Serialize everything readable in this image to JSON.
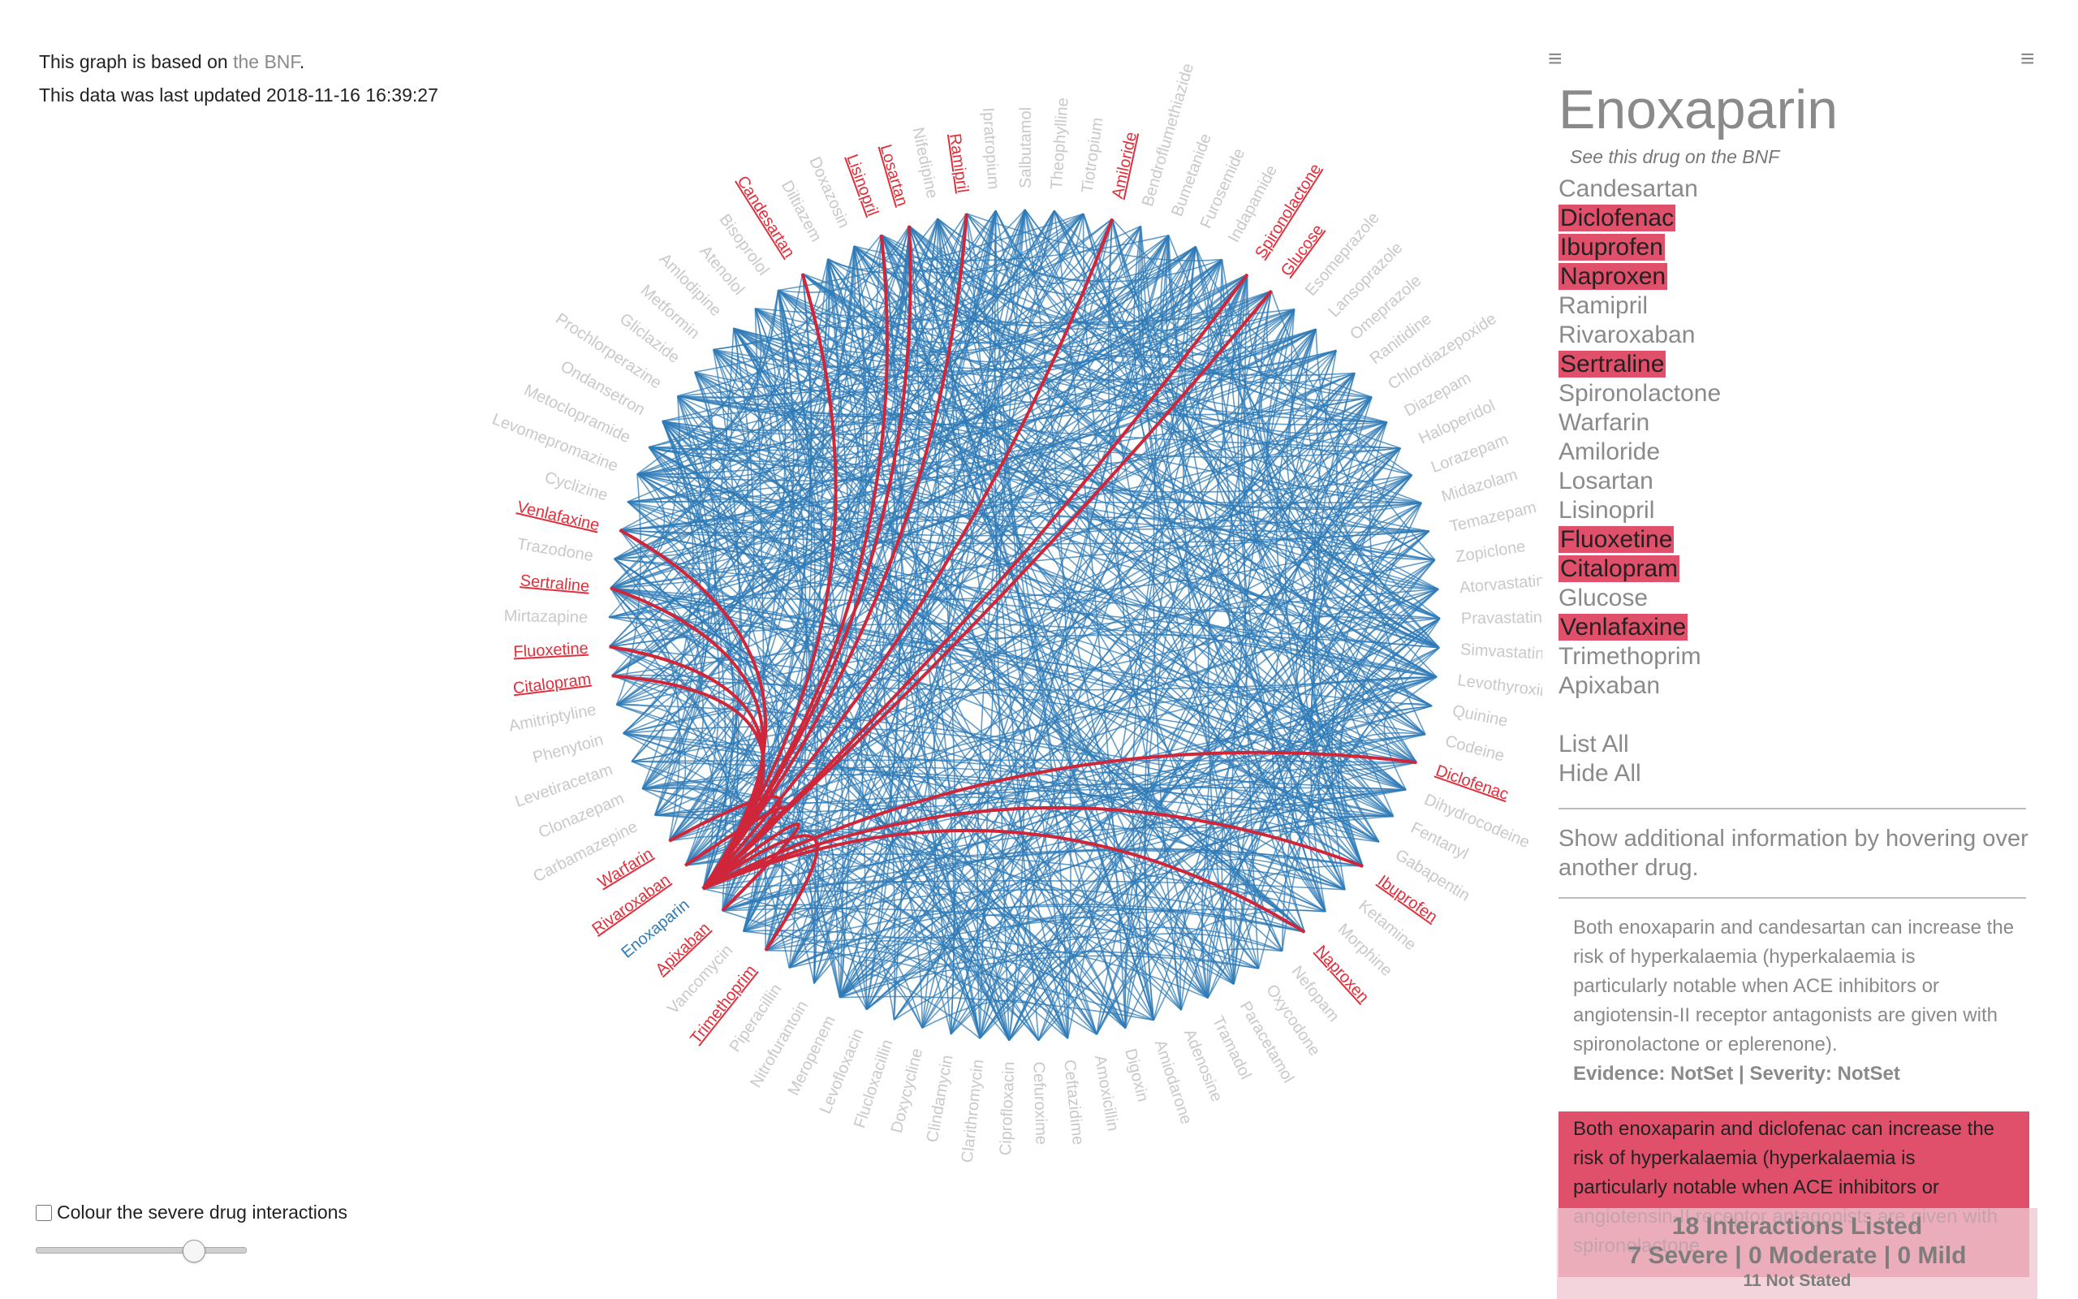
{
  "info": {
    "line1_prefix": "This graph is based on ",
    "line1_link": "the BNF",
    "line1_suffix": ".",
    "line2": "This data was last updated 2018-11-16 16:39:27"
  },
  "controls": {
    "severe_checkbox_label": "Colour the severe drug interactions",
    "slider_value_fraction": 0.78
  },
  "colors": {
    "edge": "#2f7bb7",
    "severe_edge": "#d0263a",
    "label": "#c9c9c9",
    "highlight": "#e0303c",
    "panel_highlight": "#e0506a"
  },
  "graph": {
    "focus_drug": "Enoxaparin",
    "drugs": [
      {
        "name": "Ipratropium"
      },
      {
        "name": "Salbutamol"
      },
      {
        "name": "Theophylline"
      },
      {
        "name": "Tiotropium"
      },
      {
        "name": "Amiloride",
        "hl": true
      },
      {
        "name": "Bendroflumethiazide"
      },
      {
        "name": "Bumetanide"
      },
      {
        "name": "Furosemide"
      },
      {
        "name": "Indapamide"
      },
      {
        "name": "Spironolactone",
        "hl": true
      },
      {
        "name": "Glucose",
        "hl": true
      },
      {
        "name": "Esomeprazole"
      },
      {
        "name": "Lansoprazole"
      },
      {
        "name": "Omeprazole"
      },
      {
        "name": "Ranitidine"
      },
      {
        "name": "Chlordiazepoxide"
      },
      {
        "name": "Diazepam"
      },
      {
        "name": "Haloperidol"
      },
      {
        "name": "Lorazepam"
      },
      {
        "name": "Midazolam"
      },
      {
        "name": "Temazepam"
      },
      {
        "name": "Zopiclone"
      },
      {
        "name": "Atorvastatin"
      },
      {
        "name": "Pravastatin"
      },
      {
        "name": "Simvastatin"
      },
      {
        "name": "Levothyroxine"
      },
      {
        "name": "Quinine"
      },
      {
        "name": "Codeine"
      },
      {
        "name": "Diclofenac",
        "hl": true
      },
      {
        "name": "Dihydrocodeine"
      },
      {
        "name": "Fentanyl"
      },
      {
        "name": "Gabapentin"
      },
      {
        "name": "Ibuprofen",
        "hl": true
      },
      {
        "name": "Ketamine"
      },
      {
        "name": "Morphine"
      },
      {
        "name": "Naproxen",
        "hl": true
      },
      {
        "name": "Nefopam"
      },
      {
        "name": "Oxycodone"
      },
      {
        "name": "Paracetamol"
      },
      {
        "name": "Tramadol"
      },
      {
        "name": "Adenosine"
      },
      {
        "name": "Amiodarone"
      },
      {
        "name": "Digoxin"
      },
      {
        "name": "Amoxicillin"
      },
      {
        "name": "Ceftazidime"
      },
      {
        "name": "Cefuroxime"
      },
      {
        "name": "Ciprofloxacin"
      },
      {
        "name": "Clarithromycin"
      },
      {
        "name": "Clindamycin"
      },
      {
        "name": "Doxycycline"
      },
      {
        "name": "Flucloxacillin"
      },
      {
        "name": "Levofloxacin"
      },
      {
        "name": "Meropenem"
      },
      {
        "name": "Nitrofurantoin"
      },
      {
        "name": "Piperacillin"
      },
      {
        "name": "Trimethoprim",
        "hl": true
      },
      {
        "name": "Vancomycin"
      },
      {
        "name": "Apixaban",
        "hl": true
      },
      {
        "name": "Enoxaparin",
        "focus": true
      },
      {
        "name": "Rivaroxaban",
        "hl": true
      },
      {
        "name": "Warfarin",
        "hl": true
      },
      {
        "name": "Carbamazepine"
      },
      {
        "name": "Clonazepam"
      },
      {
        "name": "Levetiracetam"
      },
      {
        "name": "Phenytoin"
      },
      {
        "name": "Amitriptyline"
      },
      {
        "name": "Citalopram",
        "hl": true
      },
      {
        "name": "Fluoxetine",
        "hl": true
      },
      {
        "name": "Mirtazapine"
      },
      {
        "name": "Sertraline",
        "hl": true
      },
      {
        "name": "Trazodone"
      },
      {
        "name": "Venlafaxine",
        "hl": true
      },
      {
        "name": "Cyclizine"
      },
      {
        "name": "Levomepromazine"
      },
      {
        "name": "Metoclopramide"
      },
      {
        "name": "Ondansetron"
      },
      {
        "name": "Prochlorperazine"
      },
      {
        "name": "Gliclazide"
      },
      {
        "name": "Metformin"
      },
      {
        "name": "Amlodipine"
      },
      {
        "name": "Atenolol"
      },
      {
        "name": "Bisoprolol"
      },
      {
        "name": "Candesartan",
        "hl": true
      },
      {
        "name": "Diltiazem"
      },
      {
        "name": "Doxazosin"
      },
      {
        "name": "Lisinopril",
        "hl": true
      },
      {
        "name": "Losartan",
        "hl": true
      },
      {
        "name": "Nifedipine"
      },
      {
        "name": "Ramipril",
        "hl": true
      }
    ]
  },
  "panel": {
    "title": "Enoxaparin",
    "bnf_link": "See this drug on the BNF",
    "drugs": [
      {
        "name": "Candesartan",
        "severe": false
      },
      {
        "name": "Diclofenac",
        "severe": true
      },
      {
        "name": "Ibuprofen",
        "severe": true
      },
      {
        "name": "Naproxen",
        "severe": true
      },
      {
        "name": "Ramipril",
        "severe": false
      },
      {
        "name": "Rivaroxaban",
        "severe": false
      },
      {
        "name": "Sertraline",
        "severe": true
      },
      {
        "name": "Spironolactone",
        "severe": false
      },
      {
        "name": "Warfarin",
        "severe": false
      },
      {
        "name": "Amiloride",
        "severe": false
      },
      {
        "name": "Losartan",
        "severe": false
      },
      {
        "name": "Lisinopril",
        "severe": false
      },
      {
        "name": "Fluoxetine",
        "severe": true
      },
      {
        "name": "Citalopram",
        "severe": true
      },
      {
        "name": "Glucose",
        "severe": false
      },
      {
        "name": "Venlafaxine",
        "severe": true
      },
      {
        "name": "Trimethoprim",
        "severe": false
      },
      {
        "name": "Apixaban",
        "severe": false
      }
    ],
    "list_all": "List All",
    "hide_all": "Hide All",
    "hover_hint": "Show additional information by hovering over another drug.",
    "interactions": [
      {
        "text": "Both enoxaparin and candesartan can increase the risk of hyperkalaemia (hyperkalaemia is particularly notable when ACE inhibitors or angiotensin-II receptor antagonists are given with spironolactone or eplerenone).",
        "evidence": "Evidence: NotSet | Severity: NotSet",
        "severe": false
      },
      {
        "text": "Both enoxaparin and diclofenac can increase the risk of hyperkalaemia (hyperkalaemia is particularly notable when ACE inhibitors or angiotensin-II receptor antagonists are given with spironolactone",
        "severe": true
      }
    ]
  },
  "summary": {
    "listed": "18 Interactions Listed",
    "breakdown": "7 Severe | 0 Moderate | 0 Mild",
    "not_stated": "11 Not Stated"
  }
}
